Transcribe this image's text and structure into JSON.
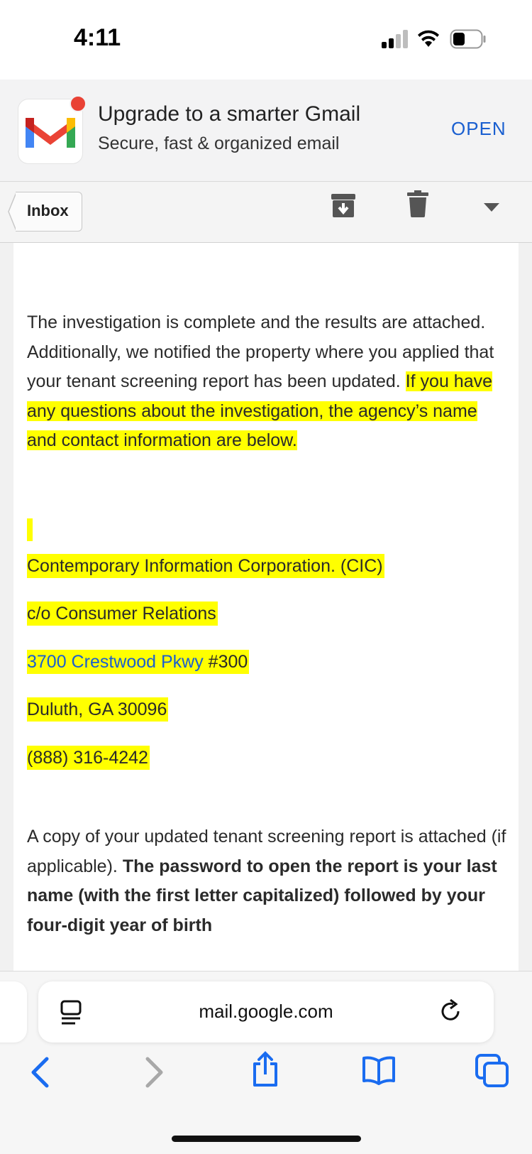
{
  "status": {
    "time": "4:11"
  },
  "promo": {
    "title": "Upgrade to a smarter Gmail",
    "subtitle": "Secure, fast & organized email",
    "action": "OPEN"
  },
  "toolbar": {
    "back_label": "Inbox",
    "icons": [
      "archive-icon",
      "trash-icon",
      "dropdown-caret-icon"
    ]
  },
  "email": {
    "p1_plain": "The investigation is complete and the results are attached. Additionally, we notified the property where you applied that your tenant screening report has been updated. ",
    "p1_highlight": "If you have any questions about the investigation, the agency’s name and contact information are below.",
    "agency_name": "Contemporary Information Corporation. (CIC)",
    "agency_dept": "c/o Consumer Relations",
    "address_link": "3700 Crestwood Pkwy",
    "address_suite": " #300",
    "city_state": "Duluth, GA 30096",
    "phone": "(888) 316-4242",
    "p2_plain": "A copy of your updated tenant screening report is attached (if applicable). ",
    "p2_bold": "The password to open the report is your last name (with the first letter capitalized) followed by your four-digit year of birth"
  },
  "safari": {
    "url": "mail.google.com",
    "icons": [
      "reader-icon",
      "reload-icon",
      "back-icon",
      "forward-icon",
      "share-icon",
      "bookmarks-icon",
      "tabs-icon"
    ]
  },
  "colors": {
    "highlight": "#ffff00",
    "link": "#1a5fd0",
    "gmail_red": "#e94235"
  }
}
